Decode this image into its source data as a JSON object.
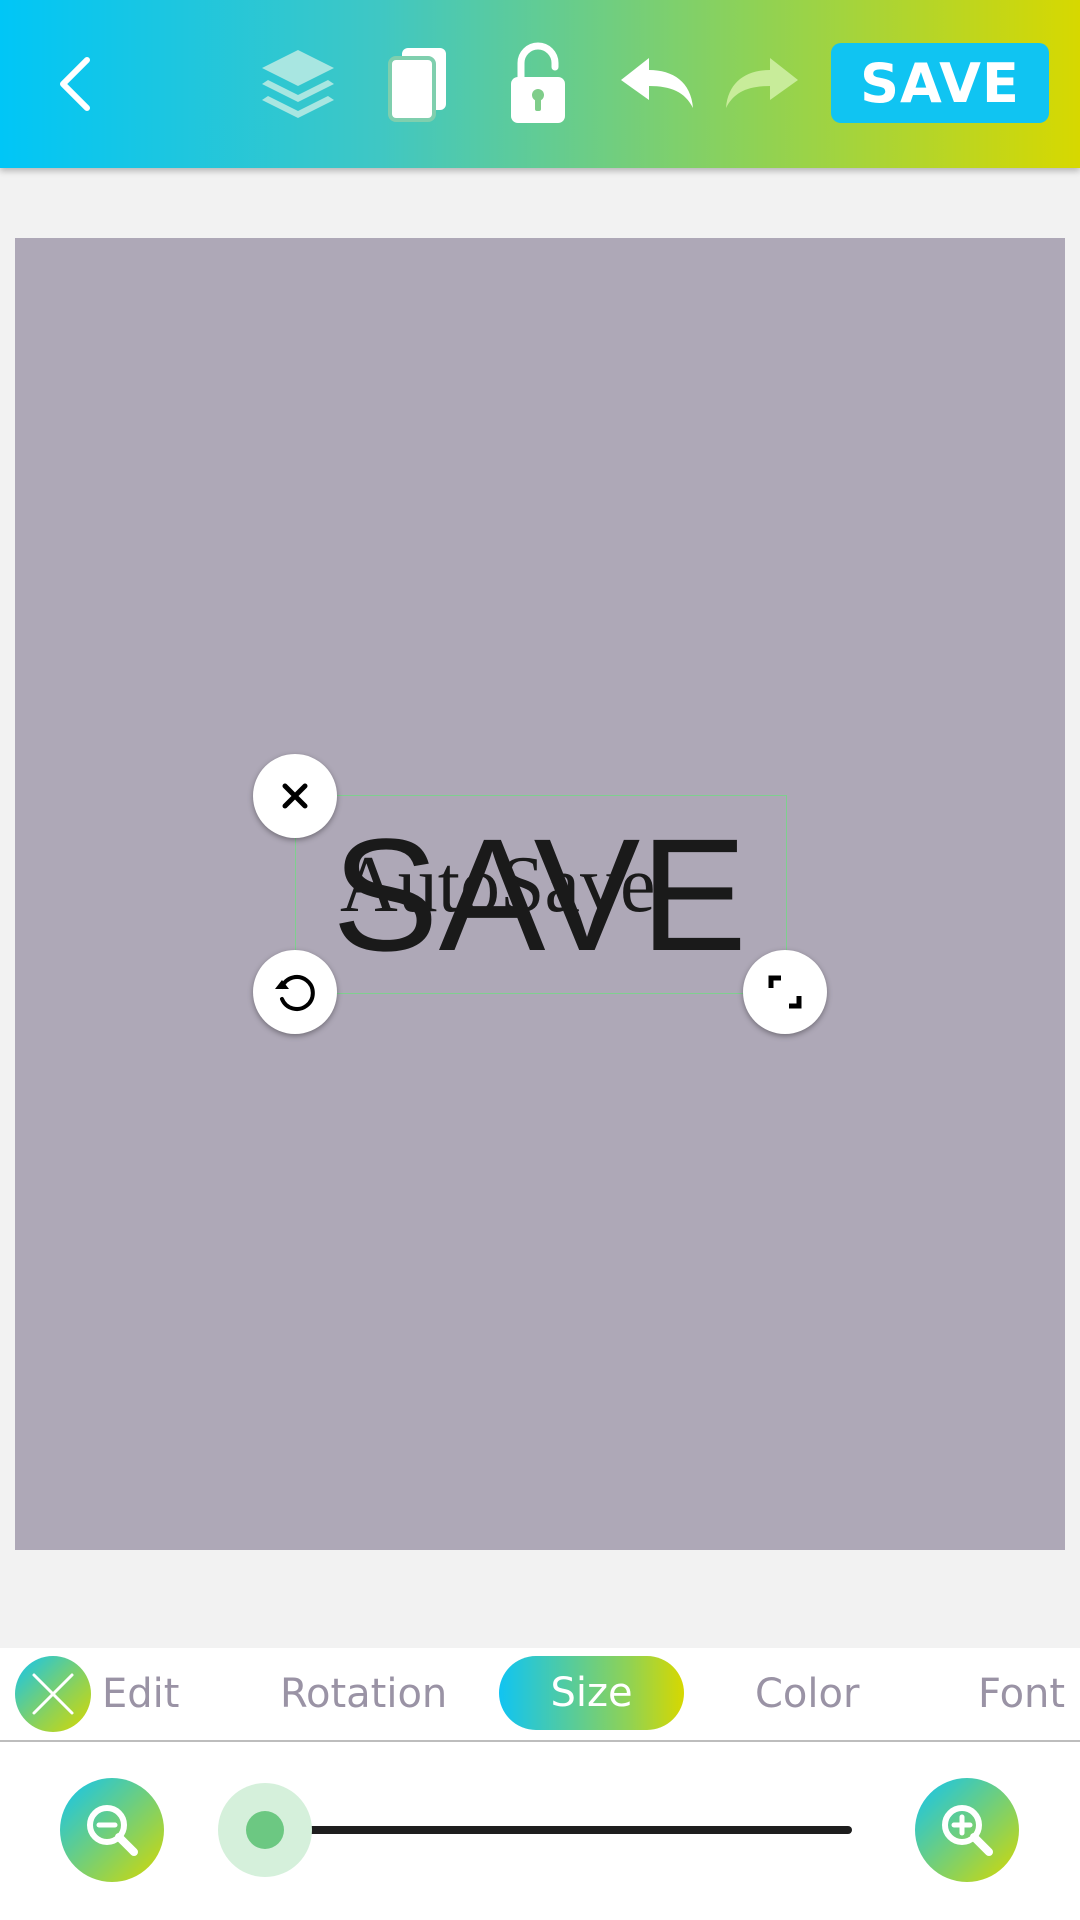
{
  "toolbar": {
    "back_icon": "chevron-left-icon",
    "layers_icon": "layers-icon",
    "duplicate_icon": "copy-icon",
    "lock_icon": "unlock-icon",
    "undo_icon": "undo-icon",
    "redo_icon": "redo-icon",
    "save_label": "SAVE"
  },
  "canvas": {
    "background_color": "#aea8b7",
    "text_back": "AutoSave",
    "text_front": "SAVE"
  },
  "handles": {
    "delete_icon": "close-icon",
    "rotate_icon": "rotate-icon",
    "resize_icon": "resize-icon"
  },
  "tabs": {
    "items": [
      {
        "label": "Edit"
      },
      {
        "label": "Rotation"
      },
      {
        "label": "Size"
      },
      {
        "label": "Color"
      },
      {
        "label": "Font"
      }
    ],
    "active": "Size"
  },
  "size_slider": {
    "value_fraction": 0.06,
    "minus_icon": "zoom-out-icon",
    "plus_icon": "zoom-in-icon"
  },
  "colors": {
    "accent_cyan": "#10c4f2",
    "accent_green": "#8fd255",
    "accent_yellow": "#d7d800",
    "slider_green": "#6cc882"
  }
}
